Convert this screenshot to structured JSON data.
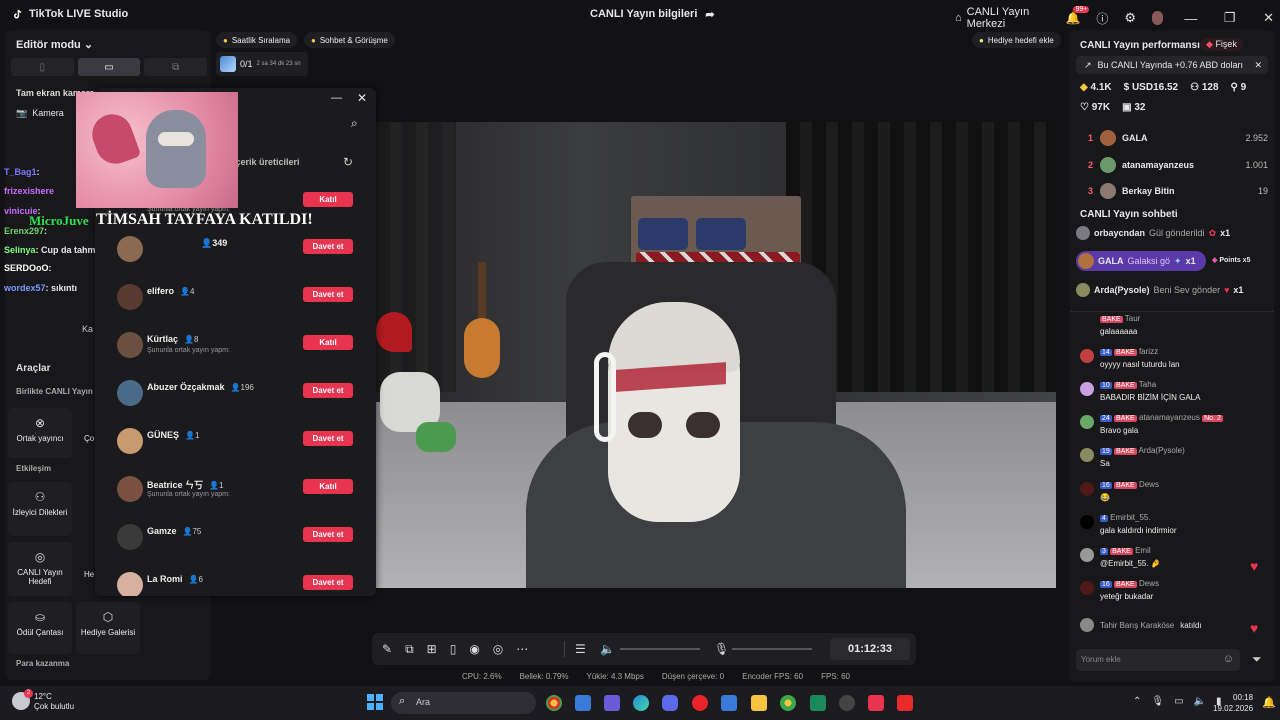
{
  "app": {
    "name": "TikTok LIVE Studio",
    "center_title": "CANLI Yayın bilgileri",
    "live_center": "CANLI Yayın Merkezi",
    "notif_count": "99+"
  },
  "left": {
    "editor_mode": "Editör modu",
    "fullscreen_camera": "Tam ekran kamera",
    "camera": "Kamera",
    "tools_title": "Araçlar",
    "together_live": "Birlikte CANLI Yayın",
    "cohost": "Ortak yayıncı",
    "engagement": "Etkileşim",
    "viewer_requests": "İzleyici Dilekleri",
    "live_goal": "CANLI Yayın Hedefi",
    "reward_bag": "Ödül Çantası",
    "gift_gallery": "Hediye Galerisi",
    "earn_money": "Para kazanma",
    "partial_a": "Ka",
    "partial_b": "Ço",
    "partial_c": "He"
  },
  "overlay_chat": [
    {
      "name": "T_Bag1",
      "text": ":",
      "color": "#7b7bff"
    },
    {
      "name": "frizexishere",
      "text": "",
      "color": "#c86bff"
    },
    {
      "name": "vinicuie",
      "text": ":",
      "color": "#c86bff"
    },
    {
      "name": "Erenx297",
      "text": ":",
      "color": "#6bd46b"
    },
    {
      "name": "Selinya",
      "text": ": Cup da tahmin ediyorlar bir de",
      "color": "#7cff7c"
    },
    {
      "name": "SERDOoO",
      "text": ":",
      "color": "#ffffff"
    },
    {
      "name": "wordex57",
      "text": ": sıkıntı",
      "color": "#7b9bff"
    }
  ],
  "overlay_banner": {
    "prefix": "MicroJuve",
    "text": "TİMSAH TAYFAYA KATILDI!"
  },
  "pills": {
    "hourly": "Saatlik Sıralama",
    "chat_meet": "Sohbet & Görüşme",
    "gift_goal": "Hediye hedefi ekle"
  },
  "goal": {
    "count": "0/1",
    "time": "2 sa 34 dk 23 sn"
  },
  "popup": {
    "tab": "içerik üreticileri",
    "guests": [
      {
        "name": "",
        "sub": "Şununla ortak yayın yapm:",
        "count": "",
        "action": "Katıl"
      },
      {
        "name": "",
        "sub": "",
        "count": "349",
        "action": "Davet et"
      },
      {
        "name": "elifero",
        "sub": "",
        "count": "4",
        "action": "Davet et"
      },
      {
        "name": "Kürtlaç",
        "sub": "Şununla ortak yayın yapm:",
        "count": "8",
        "action": "Katıl"
      },
      {
        "name": "Abuzer Özçakmak",
        "sub": "",
        "count": "196",
        "action": "Davet et"
      },
      {
        "name": "GÜNEŞ",
        "sub": "",
        "count": "1",
        "action": "Davet et"
      },
      {
        "name": "Beatrice ㄣ丂",
        "sub": "Şununla ortak yayın yapm:",
        "count": "1",
        "action": "Katıl"
      },
      {
        "name": "Gamze",
        "sub": "",
        "count": "75",
        "action": "Davet et"
      },
      {
        "name": "La Romi",
        "sub": "",
        "count": "6",
        "action": "Davet et"
      }
    ]
  },
  "right": {
    "perf_title": "CANLI Yayın performansı",
    "firework": "Fişek",
    "earning_note": "Bu CANLI Yayında +0.76 ABD doları",
    "stats": {
      "diamonds": "4.1K",
      "usd": "USD16.52",
      "viewers": "128",
      "new_followers": "9",
      "likes": "97K",
      "gifters": "32"
    },
    "ranking": [
      {
        "rank": "1",
        "user": "GALA",
        "value": "2.952"
      },
      {
        "rank": "2",
        "user": "atanamayanzeus",
        "value": "1.001"
      },
      {
        "rank": "3",
        "user": "Berkay Bitin",
        "value": "19"
      }
    ],
    "chat_title": "CANLI Yayın sohbeti",
    "gift_events": [
      {
        "user": "orbaycndan",
        "text": "Gül gönderildi",
        "mult": "x1"
      },
      {
        "user": "GALA",
        "text": "Galaksi gö",
        "mult": "x1",
        "points": "Points x5"
      },
      {
        "user": "Arda(Pysole)",
        "text": "Beni Sev gönder",
        "mult": "x1"
      }
    ],
    "messages": [
      {
        "level": "",
        "fan": "BAKE",
        "user": "Taur",
        "text": "galaaaaaa",
        "color": "#6b6bd4"
      },
      {
        "level": "14",
        "fan": "BAKE",
        "user": "farizz",
        "text": "oyyyy nasıl tuturdu lan",
        "color": "#c24040"
      },
      {
        "level": "10",
        "fan": "BAKE",
        "user": "Taha",
        "text": "BABADIR BİZİM İÇİN GALA",
        "color": "#c8a0e0"
      },
      {
        "level": "24",
        "fan": "BAKE",
        "user": "atanamayanzeus",
        "text": "Bravo gala",
        "extra": "No. 2",
        "color": "#6aa86a"
      },
      {
        "level": "19",
        "fan": "BAKE",
        "user": "Arda(Pysole)",
        "text": "Sa",
        "color": "#8a8a60"
      },
      {
        "level": "16",
        "fan": "BAKE",
        "user": "Dews",
        "text": "😂",
        "color": "#501818"
      },
      {
        "level": "4",
        "fan": "",
        "user": "Emirbit_55.",
        "text": "gala kaldırdı indirmior",
        "color": "#000000"
      },
      {
        "level": "3",
        "fan": "BAKE",
        "user": "Emil",
        "text": "@Emirbit_55. 🤌",
        "color": "#999999"
      },
      {
        "level": "16",
        "fan": "BAKE",
        "user": "Dews",
        "text": "yeteğr bukadar",
        "color": "#501818"
      }
    ],
    "join_event": {
      "user": "Tahir Barış Karaköse",
      "text": "katıldı"
    },
    "comment_placeholder": "Yorum ekle"
  },
  "controls": {
    "timer": "01:12:33"
  },
  "stats_bar": {
    "cpu": "CPU: 2.6%",
    "memory": "Bellek: 0.79%",
    "upload": "Yükle: 4.3 Mbps",
    "dropped": "Düşen çerçeve: 0",
    "encoder_fps": "Encoder FPS: 60",
    "fps": "FPS: 60"
  },
  "taskbar": {
    "temp": "12°C",
    "weather": "Çok bulutlu",
    "search": "Ara",
    "time": "00:18",
    "date": "19.02.2026",
    "weather_badge": "2"
  }
}
